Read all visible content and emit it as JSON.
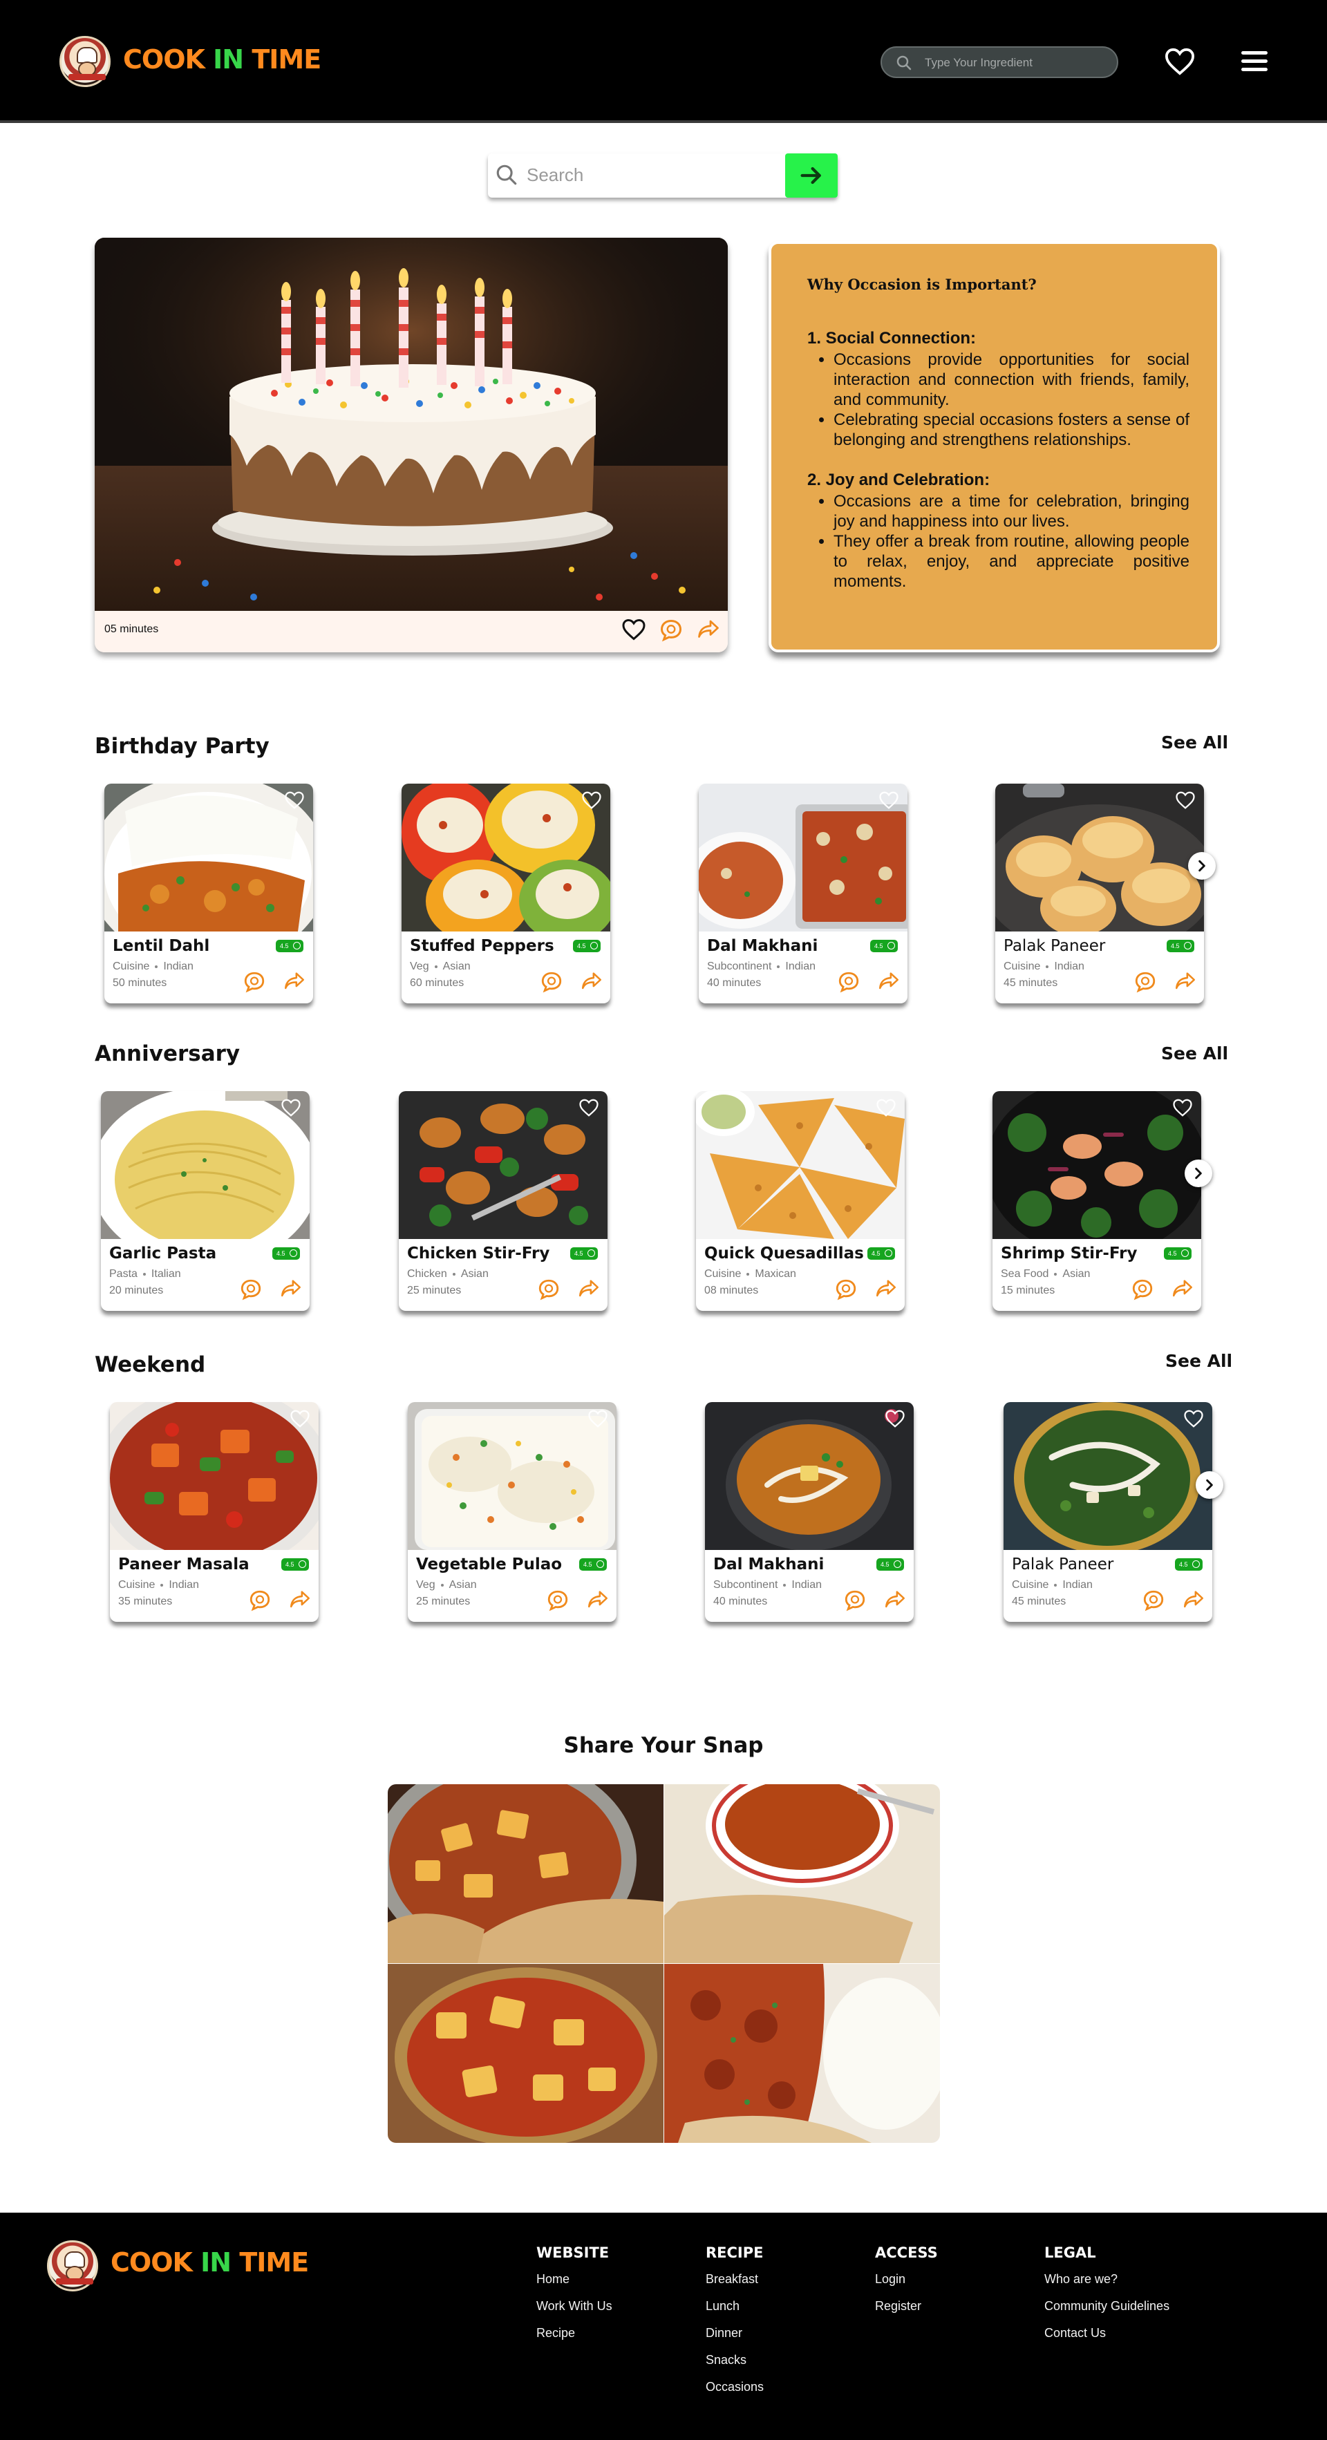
{
  "header": {
    "brand_part1": "COOK ",
    "brand_part2": "IN",
    "brand_part3": " TIME",
    "search_placeholder": "Type Your Ingredient"
  },
  "search": {
    "placeholder": "Search"
  },
  "hero": {
    "time": "05 minutes",
    "info": {
      "title": "Why Occasion is Important?",
      "sections": [
        {
          "heading": "1. Social Connection:",
          "points": [
            "Occasions provide opportunities for social interaction and connection with friends, family, and community.",
            "Celebrating special occasions fosters a sense of belonging and strengthens relationships."
          ]
        },
        {
          "heading": "2. Joy and Celebration:",
          "points": [
            "Occasions are a time for celebration, bringing joy and happiness into our lives.",
            "They offer a break from routine, allowing people to relax, enjoy, and appreciate positive moments."
          ]
        }
      ]
    }
  },
  "sections": [
    {
      "title": "Birthday Party",
      "see_all": "See All",
      "cards": [
        {
          "name": "Lentil Dahl",
          "rating": "4.5",
          "cat": "Cuisine",
          "cuisine": "Indian",
          "time": "50 minutes"
        },
        {
          "name": "Stuffed Peppers",
          "rating": "4.5",
          "cat": "Veg",
          "cuisine": "Asian",
          "time": "60 minutes"
        },
        {
          "name": "Dal Makhani",
          "rating": "4.5",
          "cat": "Subcontinent",
          "cuisine": "Indian",
          "time": "40 minutes"
        },
        {
          "name": "Palak Paneer",
          "rating": "4.5",
          "cat": "Cuisine",
          "cuisine": "Indian",
          "time": "45 minutes"
        }
      ]
    },
    {
      "title": "Anniversary",
      "see_all": "See All",
      "cards": [
        {
          "name": "Garlic Pasta",
          "rating": "4.5",
          "cat": "Pasta",
          "cuisine": "Italian",
          "time": "20 minutes"
        },
        {
          "name": "Chicken Stir-Fry",
          "rating": "4.5",
          "cat": "Chicken",
          "cuisine": "Asian",
          "time": "25 minutes"
        },
        {
          "name": "Quick Quesadillas",
          "rating": "4.5",
          "cat": "Cuisine",
          "cuisine": "Maxican",
          "time": "08 minutes"
        },
        {
          "name": "Shrimp Stir-Fry",
          "rating": "4.5",
          "cat": "Sea Food",
          "cuisine": "Asian",
          "time": "15 minutes"
        }
      ]
    },
    {
      "title": "Weekend",
      "see_all": "See All",
      "cards": [
        {
          "name": "Paneer Masala",
          "rating": "4.5",
          "cat": "Cuisine",
          "cuisine": "Indian",
          "time": "35 minutes"
        },
        {
          "name": "Vegetable Pulao",
          "rating": "4.5",
          "cat": "Veg",
          "cuisine": "Asian",
          "time": "25 minutes"
        },
        {
          "name": "Dal Makhani",
          "rating": "4.5",
          "cat": "Subcontinent",
          "cuisine": "Indian",
          "time": "40 minutes"
        },
        {
          "name": "Palak Paneer",
          "rating": "4.5",
          "cat": "Cuisine",
          "cuisine": "Indian",
          "time": "45 minutes"
        }
      ]
    }
  ],
  "snap": {
    "title": "Share Your Snap"
  },
  "footer": {
    "columns": [
      {
        "title": "WEBSITE",
        "links": [
          "Home",
          "Work With Us",
          "Recipe"
        ]
      },
      {
        "title": "RECIPE",
        "links": [
          "Breakfast",
          "Lunch",
          "Dinner",
          "Snacks",
          "Occasions"
        ]
      },
      {
        "title": "ACCESS",
        "links": [
          "Login",
          "Register"
        ]
      },
      {
        "title": "LEGAL",
        "links": [
          "Who are we?",
          "Community Guidelines",
          "Contact Us"
        ]
      }
    ]
  },
  "colors": {
    "brand_orange": "#ff8a1e",
    "brand_green": "#38d64a",
    "search_go": "#27f24a",
    "info_box": "#e7a94e",
    "rating_badge": "#16a51f",
    "action_orange": "#f08a1c"
  },
  "icons": [
    "search-icon",
    "heart-icon",
    "menu-icon",
    "arrow-right-icon",
    "chat-icon",
    "share-icon",
    "chevron-right-icon",
    "star-badge-icon"
  ]
}
